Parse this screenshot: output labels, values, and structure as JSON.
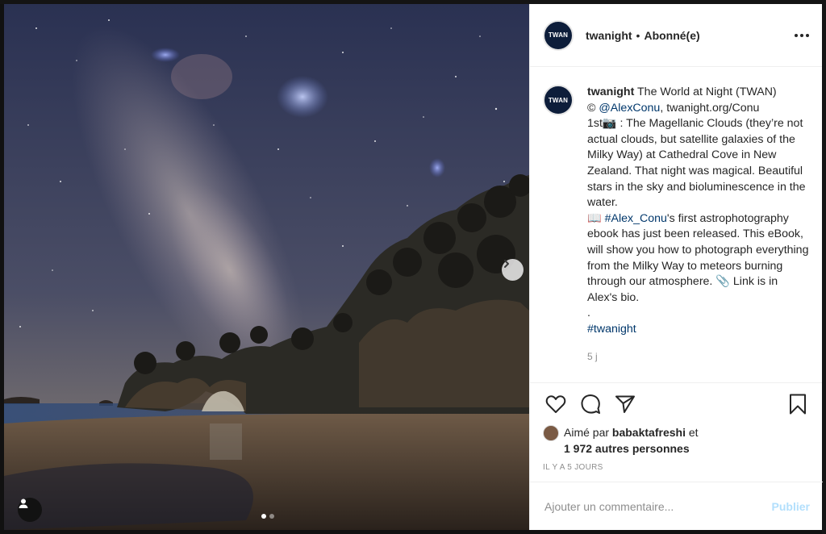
{
  "post": {
    "username": "twanight",
    "separator": "•",
    "follow_status": "Abonné(e)",
    "avatar_logo_text": "TWAN"
  },
  "caption": {
    "username": "twanight",
    "line1": " The World at Night (TWAN)",
    "line2_prefix": "© ",
    "mention": "@AlexConu",
    "line2_suffix": ", twanight.org/Conu",
    "body1": "1st📷 : The Magellanic Clouds (they’re not actual clouds, but satellite galaxies of the Milky Way) at Cathedral Cove in New Zealand. That night was magical. Beautiful stars in the sky and bioluminescence in the water.",
    "book_prefix": "📖  ",
    "hashtag1": "#Alex_Conu",
    "body2": "'s first astrophotography ebook has just been released. This eBook, will show you how to photograph everything from the Milky Way to meteors burning through our atmosphere. 📎 Link is in Alex's bio.",
    "dot": ".",
    "hashtag2": "#twanight",
    "time": "5 j"
  },
  "likes": {
    "prefix": "Aimé par ",
    "user": "babaktafreshi",
    "and": " et",
    "others": "1 972 autres personnes"
  },
  "time_ago": "IL Y A 5 JOURS",
  "comment": {
    "placeholder": "Ajouter un commentaire...",
    "publish_label": "Publier",
    "publish_color": "#b2dffc"
  },
  "carousel": {
    "total": 2,
    "active_index": 1
  },
  "icons": {
    "more": "more-horizontal-icon",
    "like": "heart-icon",
    "comment": "comment-icon",
    "share": "send-icon",
    "save": "bookmark-icon",
    "next": "chevron-right-icon",
    "user_tag": "user-icon"
  },
  "colors": {
    "text": "#262626",
    "link": "#00376b",
    "muted": "#8e8e8e"
  }
}
